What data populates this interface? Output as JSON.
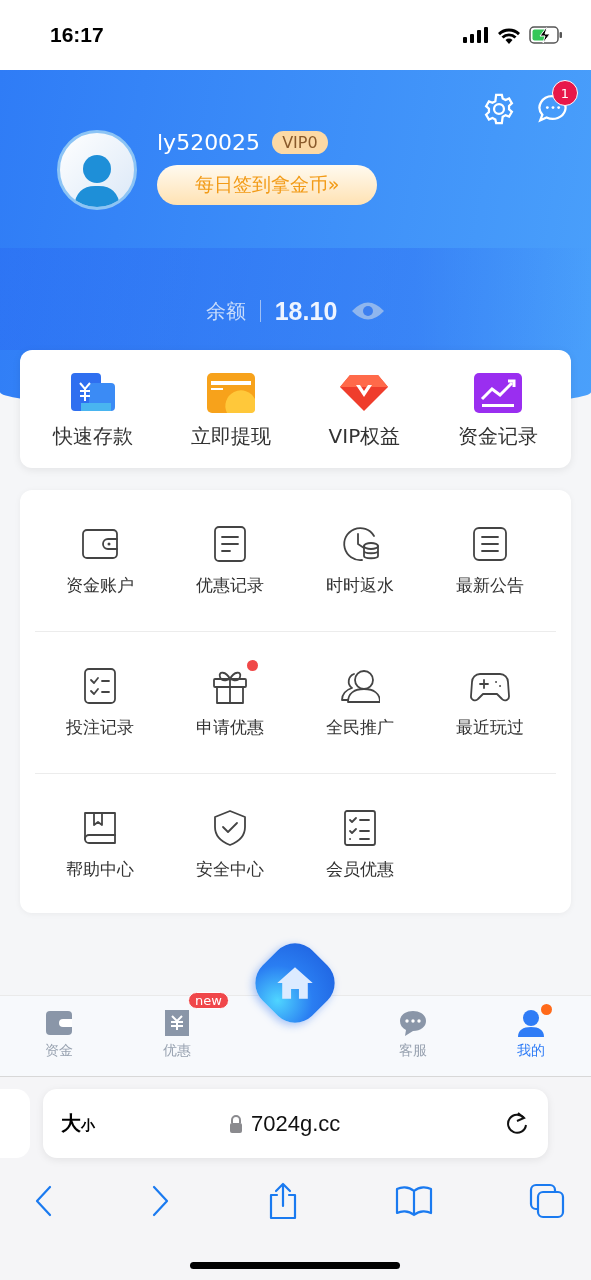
{
  "status_bar": {
    "time": "16:17"
  },
  "header": {
    "username": "ly520025",
    "vip": "VIP0",
    "checkin": "每日签到拿金币»",
    "message_badge": "1",
    "balance_label": "余额",
    "balance": "18.10"
  },
  "quick_actions": [
    {
      "label": "快速存款",
      "kind": "deposit"
    },
    {
      "label": "立即提现",
      "kind": "withdraw"
    },
    {
      "label": "VIP权益",
      "kind": "vip"
    },
    {
      "label": "资金记录",
      "kind": "records"
    }
  ],
  "menu": [
    {
      "label": "资金账户",
      "kind": "wallet",
      "dot": false
    },
    {
      "label": "优惠记录",
      "kind": "list",
      "dot": false
    },
    {
      "label": "时时返水",
      "kind": "clock",
      "dot": false
    },
    {
      "label": "最新公告",
      "kind": "notice",
      "dot": false
    },
    {
      "label": "投注记录",
      "kind": "bets",
      "dot": false
    },
    {
      "label": "申请优惠",
      "kind": "gift",
      "dot": true
    },
    {
      "label": "全民推广",
      "kind": "people",
      "dot": false
    },
    {
      "label": "最近玩过",
      "kind": "game",
      "dot": false
    },
    {
      "label": "帮助中心",
      "kind": "book",
      "dot": false
    },
    {
      "label": "安全中心",
      "kind": "shield",
      "dot": false
    },
    {
      "label": "会员优惠",
      "kind": "checklist",
      "dot": false
    }
  ],
  "tab_bar": [
    {
      "label": "资金",
      "kind": "wallet",
      "selected": false,
      "dot": false
    },
    {
      "label": "优惠",
      "kind": "promo",
      "selected": false,
      "dot": false,
      "badge": "new"
    },
    {
      "kind": "home"
    },
    {
      "label": "客服",
      "kind": "chat",
      "selected": false,
      "dot": false
    },
    {
      "label": "我的",
      "kind": "user",
      "selected": true,
      "dot": true
    }
  ],
  "browser": {
    "text_size_large": "大",
    "text_size_small": "小",
    "url": "7024g.cc"
  }
}
